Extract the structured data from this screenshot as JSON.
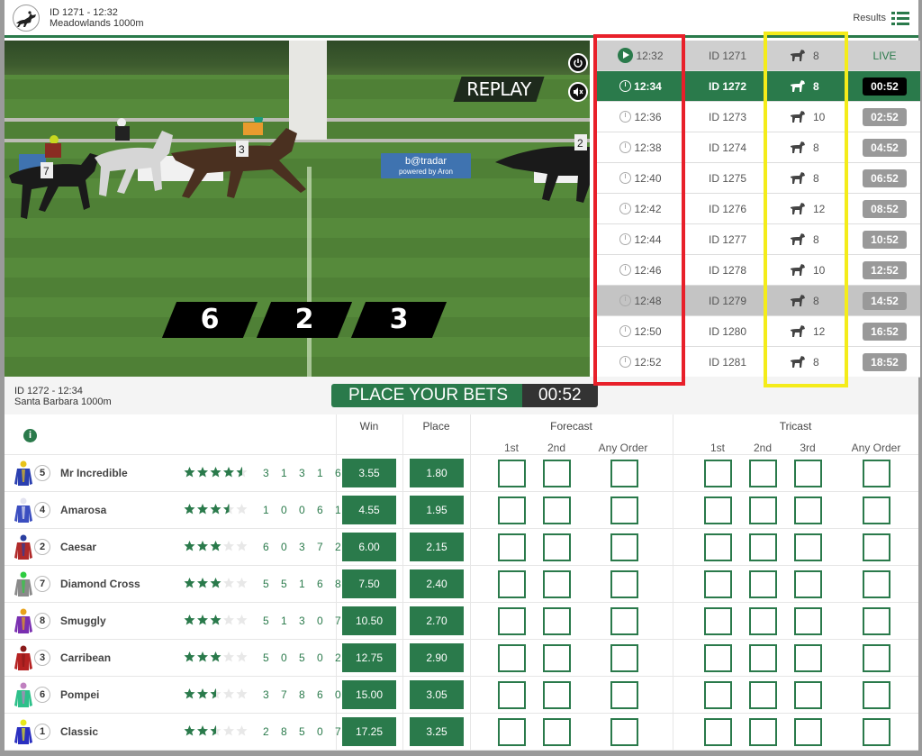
{
  "header": {
    "logo": "horse-racing-logo",
    "race_id_time": "ID 1271 - 12:32",
    "venue": "Meadowlands 1000m",
    "results_label": "Results",
    "results_icon": "list-icon"
  },
  "video": {
    "replay_label": "REPLAY",
    "power_icon": "power-icon",
    "mute_icon": "mute-icon",
    "result_positions": [
      "6",
      "2",
      "3"
    ],
    "banner_text": "b@tradar",
    "banner_subtext": "powered by Aron",
    "saddle_cloths": [
      "7",
      "3",
      "2"
    ]
  },
  "schedule": {
    "rows": [
      {
        "time": "12:32",
        "id": "ID 1271",
        "runners": "8",
        "status": "LIVE",
        "state": "live"
      },
      {
        "time": "12:34",
        "id": "ID 1272",
        "runners": "8",
        "status": "00:52",
        "state": "active"
      },
      {
        "time": "12:36",
        "id": "ID 1273",
        "runners": "10",
        "status": "02:52",
        "state": "upcoming"
      },
      {
        "time": "12:38",
        "id": "ID 1274",
        "runners": "8",
        "status": "04:52",
        "state": "upcoming"
      },
      {
        "time": "12:40",
        "id": "ID 1275",
        "runners": "8",
        "status": "06:52",
        "state": "upcoming"
      },
      {
        "time": "12:42",
        "id": "ID 1276",
        "runners": "12",
        "status": "08:52",
        "state": "upcoming"
      },
      {
        "time": "12:44",
        "id": "ID 1277",
        "runners": "8",
        "status": "10:52",
        "state": "upcoming"
      },
      {
        "time": "12:46",
        "id": "ID 1278",
        "runners": "10",
        "status": "12:52",
        "state": "upcoming"
      },
      {
        "time": "12:48",
        "id": "ID 1279",
        "runners": "8",
        "status": "14:52",
        "state": "hover"
      },
      {
        "time": "12:50",
        "id": "ID 1280",
        "runners": "12",
        "status": "16:52",
        "state": "upcoming"
      },
      {
        "time": "12:52",
        "id": "ID 1281",
        "runners": "8",
        "status": "18:52",
        "state": "upcoming"
      }
    ]
  },
  "betting": {
    "race_id_time": "ID 1272 - 12:34",
    "venue": "Santa Barbara 1000m",
    "place_bets_label": "PLACE YOUR BETS",
    "countdown": "00:52",
    "columns": {
      "win": "Win",
      "place": "Place",
      "forecast": "Forecast",
      "forecast_sub": [
        "1st",
        "2nd",
        "Any Order"
      ],
      "tricast": "Tricast",
      "tricast_sub": [
        "1st",
        "2nd",
        "3rd",
        "Any Order"
      ]
    },
    "info_icon": "info-icon",
    "runners": [
      {
        "number": "5",
        "name": "Mr Incredible",
        "rating": 4.5,
        "form": "3 1 3 1 6",
        "win": "3.55",
        "place": "1.80",
        "silk": [
          "#2a3fb0",
          "#e8c21a"
        ]
      },
      {
        "number": "4",
        "name": "Amarosa",
        "rating": 3.5,
        "form": "1 0 0 6 1",
        "win": "4.55",
        "place": "1.95",
        "silk": [
          "#3b4ec0",
          "#e3e3f0"
        ]
      },
      {
        "number": "2",
        "name": "Caesar",
        "rating": 3,
        "form": "6 0 3 7 2",
        "win": "6.00",
        "place": "2.15",
        "silk": [
          "#b02a2a",
          "#2a3fa0"
        ]
      },
      {
        "number": "7",
        "name": "Diamond Cross",
        "rating": 3,
        "form": "5 5 1 6 8",
        "win": "7.50",
        "place": "2.40",
        "silk": [
          "#8a8a8a",
          "#2ecc40"
        ]
      },
      {
        "number": "8",
        "name": "Smuggly",
        "rating": 3,
        "form": "5 1 3 0 7",
        "win": "10.50",
        "place": "2.70",
        "silk": [
          "#7a2fb0",
          "#e8a21a"
        ]
      },
      {
        "number": "3",
        "name": "Carribean",
        "rating": 3,
        "form": "5 0 5 0 2",
        "win": "12.75",
        "place": "2.90",
        "silk": [
          "#b52222",
          "#8a1a1a"
        ]
      },
      {
        "number": "6",
        "name": "Pompei",
        "rating": 2.5,
        "form": "3 7 8 6 0",
        "win": "15.00",
        "place": "3.05",
        "silk": [
          "#2ec08a",
          "#c080c0"
        ]
      },
      {
        "number": "1",
        "name": "Classic",
        "rating": 2.5,
        "form": "2 8 5 0 7",
        "win": "17.25",
        "place": "3.25",
        "silk": [
          "#2a2fc0",
          "#e8e81a"
        ]
      }
    ]
  },
  "colors": {
    "brand_green": "#2a7a4b",
    "countdown_grey": "#999999",
    "annotation_red": "#e8202a",
    "annotation_yellow": "#f4ec1a"
  }
}
